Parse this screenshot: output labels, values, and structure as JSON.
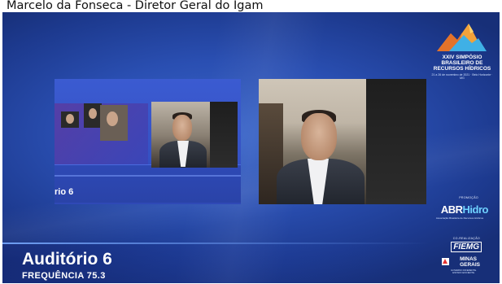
{
  "caption": "Marcelo da Fonseca - Diretor Geral do Igam",
  "share": {
    "label": "rio 6"
  },
  "branding": {
    "title_line1": "XXIV SIMPÓSIO",
    "title_line2": "BRASILEIRO DE",
    "title_line3": "RECURSOS HÍDRICOS",
    "subtitle": "21 a 26 de novembro de 2021 · Belo Horizonte · MG",
    "promotion_label": "PROMOÇÃO",
    "abrh_main": "ABR",
    "abrh_accent": "Hidro",
    "abrh_sub": "Associação Brasileira de Recursos Hídricos",
    "corealization_label": "CO-REALIZAÇÃO",
    "fiemg": "FIEMG",
    "mg_line1": "MINAS",
    "mg_line2": "GERAIS",
    "mg_sub": "GOVERNO DIFERENTE. ESTADO EFICIENTE."
  },
  "auditorium": {
    "title": "Auditório 6",
    "frequency": "FREQUÊNCIA 75.3"
  },
  "colors": {
    "background": "#2a4fb2",
    "accent_cyan": "#6fd1ff",
    "mg_red": "#e53030"
  }
}
